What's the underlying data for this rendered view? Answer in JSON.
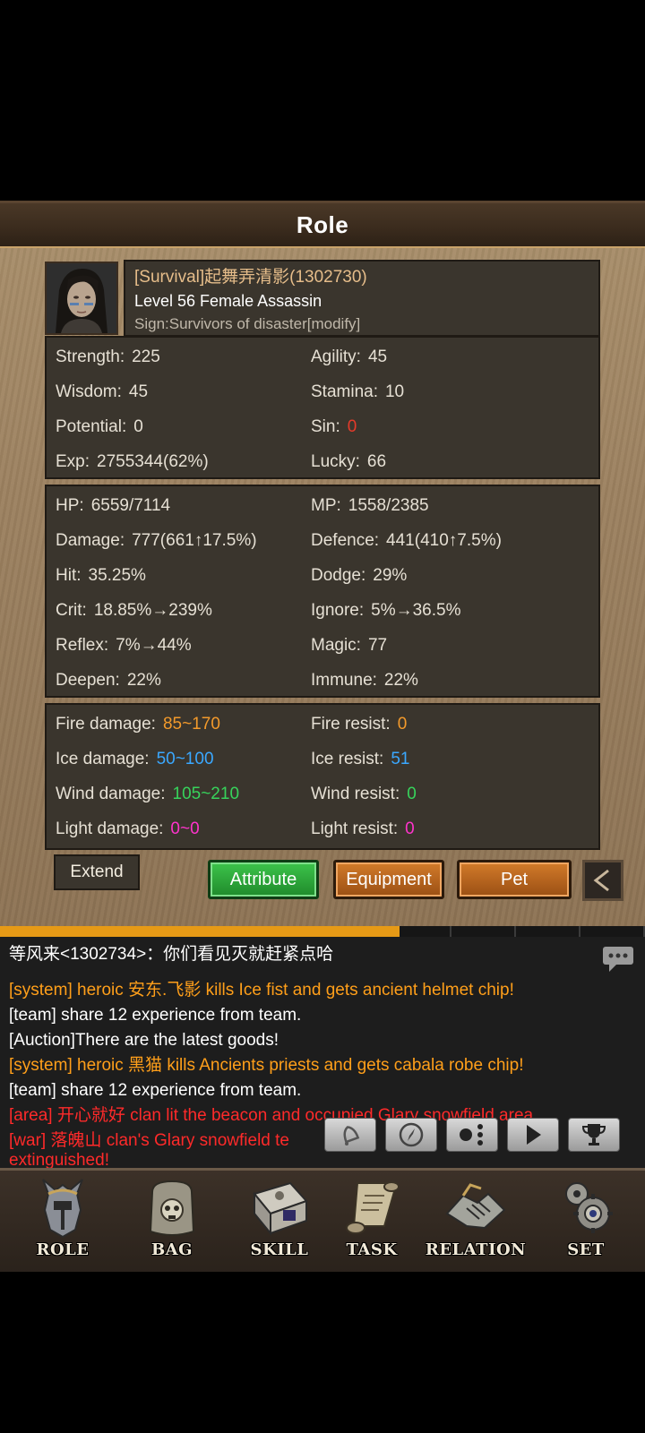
{
  "title": "Role",
  "profile": {
    "name": "[Survival]起舞弄清影(1302730)",
    "level": "Level 56 Female Assassin",
    "sign": "Sign:Survivors of disaster[modify]"
  },
  "base_stats": [
    {
      "l_label": "Strength:",
      "l_value": "225",
      "r_label": "Agility:",
      "r_value": "45"
    },
    {
      "l_label": "Wisdom:",
      "l_value": "45",
      "r_label": "Stamina:",
      "r_value": "10"
    },
    {
      "l_label": "Potential:",
      "l_value": "0",
      "r_label": "Sin:",
      "r_value": "0"
    },
    {
      "l_label": "Exp:",
      "l_value": "2755344(62%)",
      "r_label": "Lucky:",
      "r_value": "66"
    }
  ],
  "combat_stats": [
    {
      "l_label": "HP:",
      "l_value": "6559/7114",
      "r_label": "MP:",
      "r_value": "1558/2385"
    },
    {
      "l_label": "Damage:",
      "l_value": "777(661↑17.5%)",
      "r_label": "Defence:",
      "r_value": "441(410↑7.5%)"
    },
    {
      "l_label": "Hit:",
      "l_value": "35.25%",
      "r_label": "Dodge:",
      "r_value": "29%"
    },
    {
      "l_label": "Crit:",
      "l_value": "18.85%→239%",
      "r_label": "Ignore:",
      "r_value": "5%→36.5%"
    },
    {
      "l_label": "Reflex:",
      "l_value": "7%→44%",
      "r_label": "Magic:",
      "r_value": "77"
    },
    {
      "l_label": "Deepen:",
      "l_value": "22%",
      "r_label": "Immune:",
      "r_value": "22%"
    }
  ],
  "element_stats": [
    {
      "l_label": "Fire damage:",
      "l_value": "85~170",
      "r_label": "Fire resist:",
      "r_value": "0"
    },
    {
      "l_label": "Ice damage:",
      "l_value": "50~100",
      "r_label": "Ice  resist:",
      "r_value": "51"
    },
    {
      "l_label": "Wind damage:",
      "l_value": "105~210",
      "r_label": "Wind  resist:",
      "r_value": "0"
    },
    {
      "l_label": "Light damage:",
      "l_value": "0~0",
      "r_label": "Light  resist:",
      "r_value": "0"
    }
  ],
  "colors": {
    "sin": "#e53a2a",
    "fire": "#f39a2b",
    "ice": "#3aa8ff",
    "wind": "#37d35b",
    "light": "#ff33cc",
    "system": "#ff9f1a",
    "area": "#ff2a2a"
  },
  "buttons": {
    "extend": "Extend",
    "attribute": "Attribute",
    "equipment": "Equipment",
    "pet": "Pet"
  },
  "chat": {
    "header": "等风来<1302734>：你们看见灭就赶紧点哈",
    "progress": 0.62,
    "lines": [
      {
        "text": "[system] heroic 安东.飞影 kills Ice fist and gets ancient helmet chip!",
        "type": "system"
      },
      {
        "text": "[team] share 12 experience from team.",
        "type": "team"
      },
      {
        "text": "[Auction]There are the latest goods!",
        "type": "auction"
      },
      {
        "text": "[system] heroic 黑猫 kills Ancients priests and gets cabala robe chip!",
        "type": "system"
      },
      {
        "text": "[team] share 12 experience from team.",
        "type": "team"
      },
      {
        "text": "[area] 开心就好 clan lit the beacon and occupied Glary snowfield area.",
        "type": "area"
      },
      {
        "text": "[war] 落魄山 clan's Glary snowfield te",
        "type": "war"
      },
      {
        "text": "extinguished!",
        "type": "war"
      }
    ]
  },
  "menu": [
    {
      "label": "ROLE",
      "icon": "helmet-icon"
    },
    {
      "label": "BAG",
      "icon": "bag-icon"
    },
    {
      "label": "SKILL",
      "icon": "skill-book-icon"
    },
    {
      "label": "TASK",
      "icon": "scroll-icon"
    },
    {
      "label": "RELATION",
      "icon": "handshake-icon"
    },
    {
      "label": "SET",
      "icon": "gear-icon"
    }
  ]
}
